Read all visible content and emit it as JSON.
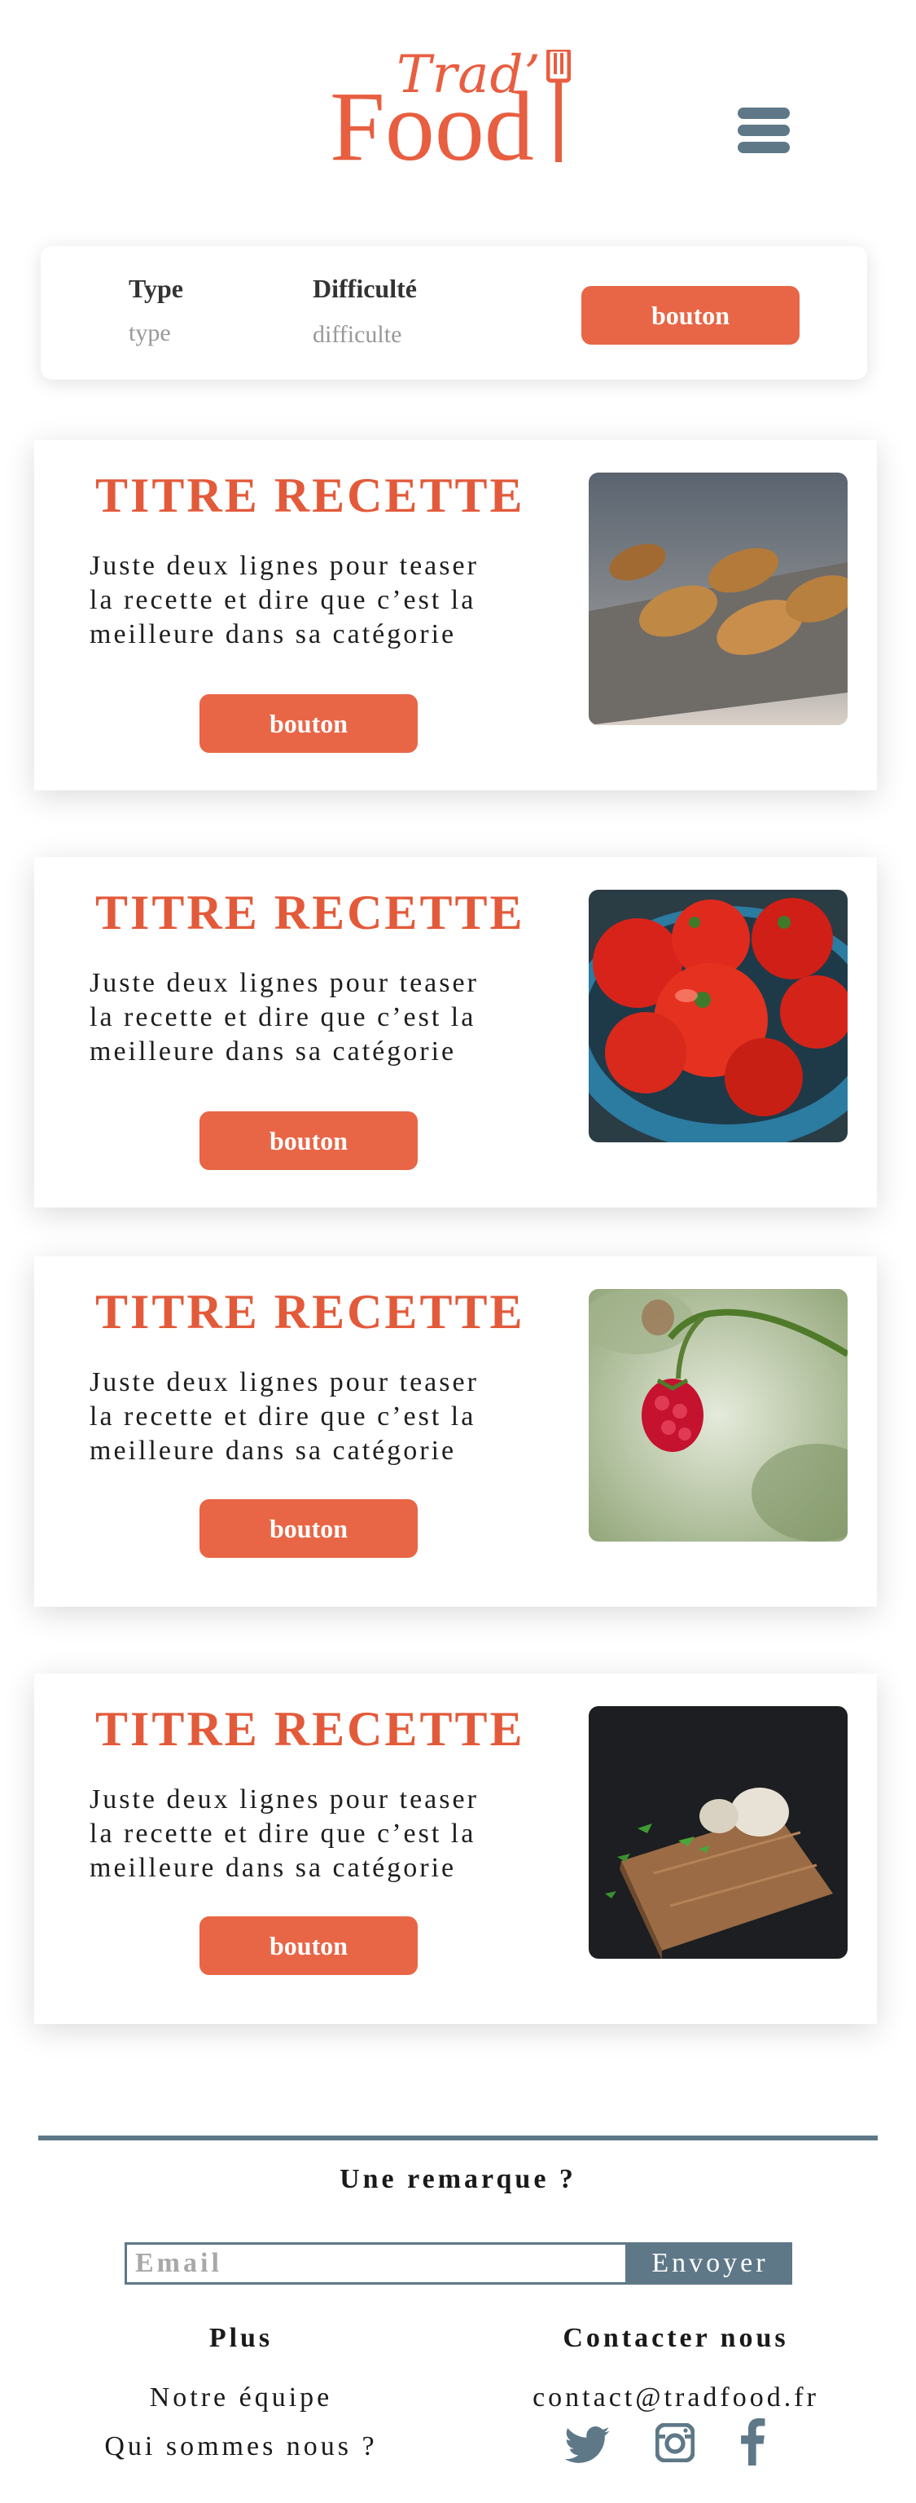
{
  "brand": {
    "script": "Trad’",
    "word": "Food",
    "color": "#e85e40"
  },
  "icons": {
    "menu": "hamburger-menu-icon",
    "fork": "fork-icon",
    "twitter": "twitter-icon",
    "instagram": "instagram-icon",
    "facebook": "facebook-icon"
  },
  "filters": {
    "type_label": "Type",
    "type_value": "type",
    "difficulty_label": "Difficulté",
    "difficulty_value": "difficulte",
    "button_label": "bouton"
  },
  "recipes": [
    {
      "title": "TITRE RECETTE",
      "desc_line1": "Juste deux lignes pour teaser",
      "desc_line2": "la recette et dire que c’est la",
      "desc_line3": "meilleure dans sa catégorie",
      "button_label": "bouton",
      "image": "croissants-photo"
    },
    {
      "title": "TITRE RECETTE",
      "desc_line1": "Juste deux lignes pour teaser",
      "desc_line2": "la recette et dire que c’est la",
      "desc_line3": "meilleure dans sa catégorie",
      "button_label": "bouton",
      "image": "tomatoes-photo"
    },
    {
      "title": "TITRE RECETTE",
      "desc_line1": "Juste deux lignes pour teaser",
      "desc_line2": "la recette et dire que c’est la",
      "desc_line3": "meilleure dans sa catégorie",
      "button_label": "bouton",
      "image": "raspberry-photo"
    },
    {
      "title": "TITRE RECETTE",
      "desc_line1": "Juste deux lignes pour teaser",
      "desc_line2": "la recette et dire que c’est la",
      "desc_line3": "meilleure dans sa catégorie",
      "button_label": "bouton",
      "image": "garlic-board-photo"
    }
  ],
  "footer": {
    "remark_heading": "Une remarque ?",
    "email_placeholder": "Email",
    "send_label": "Envoyer",
    "plus_heading": "Plus",
    "plus_links": [
      "Notre équipe",
      "Qui sommes nous ?"
    ],
    "contact_heading": "Contacter nous",
    "contact_email": "contact@tradfood.fr"
  },
  "colors": {
    "accent": "#e86646",
    "title": "#e35a3a",
    "slate": "#5e7888"
  }
}
